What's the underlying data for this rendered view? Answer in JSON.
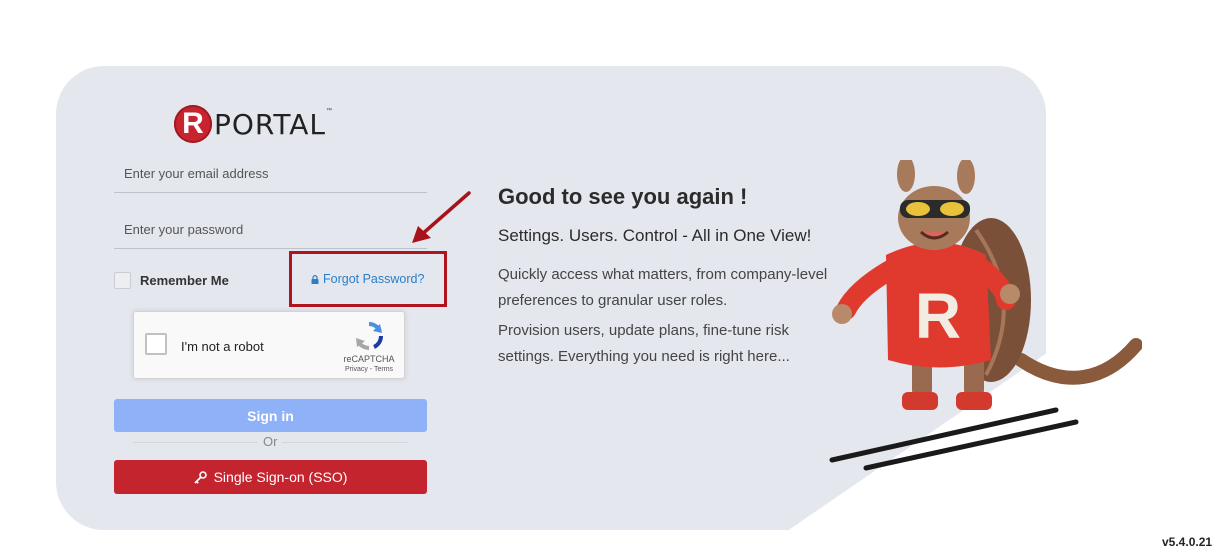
{
  "logo": {
    "letter": "R",
    "text": "PORTAL",
    "tm": "™"
  },
  "form": {
    "email_placeholder": "Enter your email address",
    "password_placeholder": "Enter your password",
    "remember_label": "Remember Me",
    "forgot_label": "Forgot Password?"
  },
  "captcha": {
    "label": "I'm not a robot",
    "brand": "reCAPTCHA",
    "links": "Privacy - Terms"
  },
  "buttons": {
    "signin_label": "Sign in",
    "or_label": "Or",
    "sso_label": "Single Sign-on (SSO)"
  },
  "welcome": {
    "heading": "Good to see you again !",
    "tagline": "Settings. Users. Control - All in One View!",
    "paragraph1": "Quickly access what matters, from company-level preferences to granular user roles.",
    "paragraph2": "Provision users, update plans, fine-tune risk settings. Everything you need is right here..."
  },
  "version": "v5.4.0.21",
  "colors": {
    "card_bg": "#e5e7ee",
    "brand_red": "#c4242e",
    "signin_blue": "#8eb1f7",
    "link_blue": "#2a7dc9",
    "highlight_red": "#b0141d"
  },
  "icons": {
    "lock": "lock-icon",
    "key": "key-icon",
    "recaptcha": "recaptcha-logo-icon",
    "annotation_arrow": "arrow-icon"
  }
}
